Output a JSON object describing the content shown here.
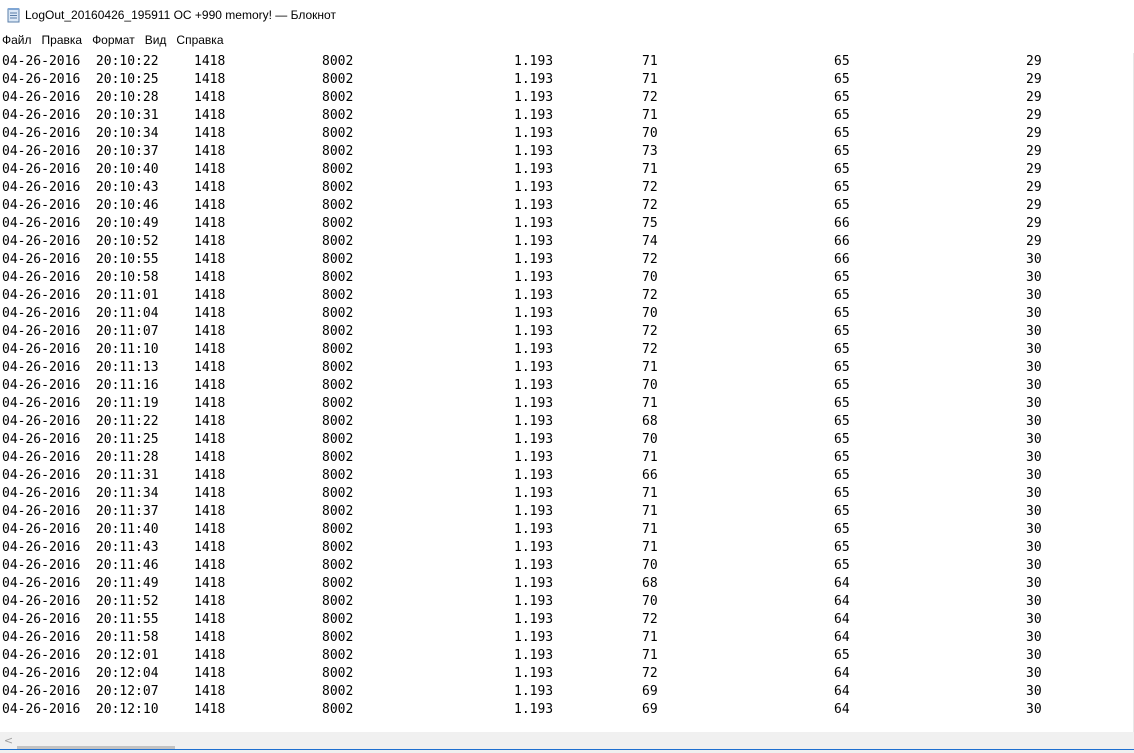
{
  "window": {
    "title": "LogOut_20160426_195911 OC +990 memory! — Блокнот",
    "icon": "notepad-icon"
  },
  "menu": {
    "items": [
      "Файл",
      "Правка",
      "Формат",
      "Вид",
      "Справка"
    ]
  },
  "log": {
    "rows": [
      [
        "04-26-2016  20:10:22",
        "1418",
        "8002",
        "1.193",
        "71",
        "65",
        "29"
      ],
      [
        "04-26-2016  20:10:25",
        "1418",
        "8002",
        "1.193",
        "71",
        "65",
        "29"
      ],
      [
        "04-26-2016  20:10:28",
        "1418",
        "8002",
        "1.193",
        "72",
        "65",
        "29"
      ],
      [
        "04-26-2016  20:10:31",
        "1418",
        "8002",
        "1.193",
        "71",
        "65",
        "29"
      ],
      [
        "04-26-2016  20:10:34",
        "1418",
        "8002",
        "1.193",
        "70",
        "65",
        "29"
      ],
      [
        "04-26-2016  20:10:37",
        "1418",
        "8002",
        "1.193",
        "73",
        "65",
        "29"
      ],
      [
        "04-26-2016  20:10:40",
        "1418",
        "8002",
        "1.193",
        "71",
        "65",
        "29"
      ],
      [
        "04-26-2016  20:10:43",
        "1418",
        "8002",
        "1.193",
        "72",
        "65",
        "29"
      ],
      [
        "04-26-2016  20:10:46",
        "1418",
        "8002",
        "1.193",
        "72",
        "65",
        "29"
      ],
      [
        "04-26-2016  20:10:49",
        "1418",
        "8002",
        "1.193",
        "75",
        "66",
        "29"
      ],
      [
        "04-26-2016  20:10:52",
        "1418",
        "8002",
        "1.193",
        "74",
        "66",
        "29"
      ],
      [
        "04-26-2016  20:10:55",
        "1418",
        "8002",
        "1.193",
        "72",
        "66",
        "30"
      ],
      [
        "04-26-2016  20:10:58",
        "1418",
        "8002",
        "1.193",
        "70",
        "65",
        "30"
      ],
      [
        "04-26-2016  20:11:01",
        "1418",
        "8002",
        "1.193",
        "72",
        "65",
        "30"
      ],
      [
        "04-26-2016  20:11:04",
        "1418",
        "8002",
        "1.193",
        "70",
        "65",
        "30"
      ],
      [
        "04-26-2016  20:11:07",
        "1418",
        "8002",
        "1.193",
        "72",
        "65",
        "30"
      ],
      [
        "04-26-2016  20:11:10",
        "1418",
        "8002",
        "1.193",
        "72",
        "65",
        "30"
      ],
      [
        "04-26-2016  20:11:13",
        "1418",
        "8002",
        "1.193",
        "71",
        "65",
        "30"
      ],
      [
        "04-26-2016  20:11:16",
        "1418",
        "8002",
        "1.193",
        "70",
        "65",
        "30"
      ],
      [
        "04-26-2016  20:11:19",
        "1418",
        "8002",
        "1.193",
        "71",
        "65",
        "30"
      ],
      [
        "04-26-2016  20:11:22",
        "1418",
        "8002",
        "1.193",
        "68",
        "65",
        "30"
      ],
      [
        "04-26-2016  20:11:25",
        "1418",
        "8002",
        "1.193",
        "70",
        "65",
        "30"
      ],
      [
        "04-26-2016  20:11:28",
        "1418",
        "8002",
        "1.193",
        "71",
        "65",
        "30"
      ],
      [
        "04-26-2016  20:11:31",
        "1418",
        "8002",
        "1.193",
        "66",
        "65",
        "30"
      ],
      [
        "04-26-2016  20:11:34",
        "1418",
        "8002",
        "1.193",
        "71",
        "65",
        "30"
      ],
      [
        "04-26-2016  20:11:37",
        "1418",
        "8002",
        "1.193",
        "71",
        "65",
        "30"
      ],
      [
        "04-26-2016  20:11:40",
        "1418",
        "8002",
        "1.193",
        "71",
        "65",
        "30"
      ],
      [
        "04-26-2016  20:11:43",
        "1418",
        "8002",
        "1.193",
        "71",
        "65",
        "30"
      ],
      [
        "04-26-2016  20:11:46",
        "1418",
        "8002",
        "1.193",
        "70",
        "65",
        "30"
      ],
      [
        "04-26-2016  20:11:49",
        "1418",
        "8002",
        "1.193",
        "68",
        "64",
        "30"
      ],
      [
        "04-26-2016  20:11:52",
        "1418",
        "8002",
        "1.193",
        "70",
        "64",
        "30"
      ],
      [
        "04-26-2016  20:11:55",
        "1418",
        "8002",
        "1.193",
        "72",
        "64",
        "30"
      ],
      [
        "04-26-2016  20:11:58",
        "1418",
        "8002",
        "1.193",
        "71",
        "64",
        "30"
      ],
      [
        "04-26-2016  20:12:01",
        "1418",
        "8002",
        "1.193",
        "71",
        "65",
        "30"
      ],
      [
        "04-26-2016  20:12:04",
        "1418",
        "8002",
        "1.193",
        "72",
        "64",
        "30"
      ],
      [
        "04-26-2016  20:12:07",
        "1418",
        "8002",
        "1.193",
        "69",
        "64",
        "30"
      ],
      [
        "04-26-2016  20:12:10",
        "1418",
        "8002",
        "1.193",
        "69",
        "64",
        "30"
      ]
    ]
  },
  "scrollbar": {
    "left_arrow_icon": "chevron-left-icon",
    "left_arrow_glyph": "<"
  }
}
